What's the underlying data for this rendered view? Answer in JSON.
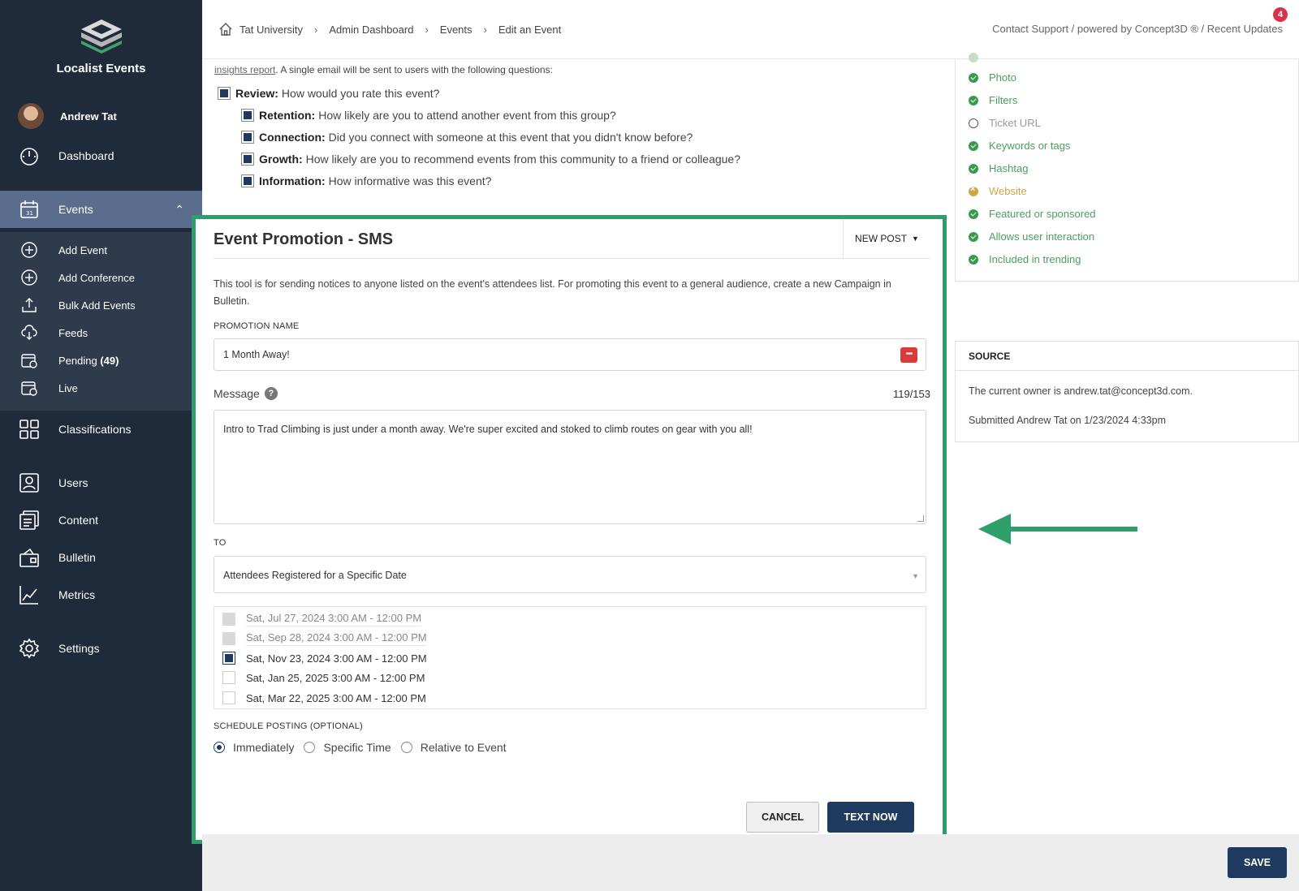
{
  "sidebar": {
    "brand": "Localist Events",
    "user_name": "Andrew Tat",
    "nav": {
      "dashboard": "Dashboard",
      "events": "Events",
      "classifications": "Classifications",
      "users": "Users",
      "content": "Content",
      "bulletin": "Bulletin",
      "metrics": "Metrics",
      "settings": "Settings"
    },
    "subnav": {
      "add_event": "Add Event",
      "add_conference": "Add Conference",
      "bulk_add": "Bulk Add Events",
      "feeds": "Feeds",
      "pending": "Pending",
      "pending_count": "(49)",
      "live": "Live"
    }
  },
  "topbar": {
    "breadcrumb": [
      "Tat University",
      "Admin Dashboard",
      "Events",
      "Edit an Event"
    ],
    "breadcrumb_sep": "›",
    "links": "Contact Support / powered by Concept3D ® / Recent Updates",
    "badge_count": "4"
  },
  "feedback": {
    "intro_link": "insights report",
    "intro_text": ". A single email will be sent to users with the following questions:",
    "questions": [
      {
        "label": "Review:",
        "text": "How would you rate this event?"
      },
      {
        "label": "Retention:",
        "text": "How likely are you to attend another event from this group?"
      },
      {
        "label": "Connection:",
        "text": "Did you connect with someone at this event that you didn't know before?"
      },
      {
        "label": "Growth:",
        "text": "How likely are you to recommend events from this community to a friend or colleague?"
      },
      {
        "label": "Information:",
        "text": "How informative was this event?"
      }
    ]
  },
  "promo": {
    "title": "Event Promotion - SMS",
    "new_post": "NEW POST",
    "description": "This tool is for sending notices to anyone listed on the event's attendees list. For promoting this event to a general audience, create a new Campaign in Bulletin.",
    "name_label": "PROMOTION NAME",
    "name_value": "1 Month Away!",
    "message_label": "Message",
    "message_counter": "119/153",
    "message_value": "Intro to Trad Climbing is just under a month away. We're super excited and stoked to climb routes on gear with you all!",
    "to_label": "TO",
    "to_value": "Attendees Registered for a Specific Date",
    "dates": [
      {
        "label": "Sat, Jul 27, 2024 3:00 AM - 12:00 PM",
        "state": "disabled"
      },
      {
        "label": "Sat, Sep 28, 2024 3:00 AM - 12:00 PM",
        "state": "disabled"
      },
      {
        "label": "Sat, Nov 23, 2024 3:00 AM - 12:00 PM",
        "state": "checked"
      },
      {
        "label": "Sat, Jan 25, 2025 3:00 AM - 12:00 PM",
        "state": "unchecked"
      },
      {
        "label": "Sat, Mar 22, 2025 3:00 AM - 12:00 PM",
        "state": "unchecked"
      }
    ],
    "schedule_label": "SCHEDULE POSTING (OPTIONAL)",
    "schedule_options": [
      "Immediately",
      "Specific Time",
      "Relative to Event"
    ],
    "schedule_selected": "Immediately",
    "cancel": "CANCEL",
    "submit": "TEXT NOW"
  },
  "checklist": [
    {
      "label": "Photo",
      "state": "done"
    },
    {
      "label": "Filters",
      "state": "done"
    },
    {
      "label": "Ticket URL",
      "state": "todo"
    },
    {
      "label": "Keywords or tags",
      "state": "done"
    },
    {
      "label": "Hashtag",
      "state": "done"
    },
    {
      "label": "Website",
      "state": "warn"
    },
    {
      "label": "Featured or sponsored",
      "state": "done"
    },
    {
      "label": "Allows user interaction",
      "state": "done"
    },
    {
      "label": "Included in trending",
      "state": "done"
    }
  ],
  "source": {
    "title": "SOURCE",
    "owner": "The current owner is andrew.tat@concept3d.com.",
    "submitted": "Submitted Andrew Tat on 1/23/2024 4:33pm"
  },
  "footer": {
    "save": "SAVE"
  },
  "colors": {
    "sidebar_bg": "#1f2a3a",
    "active_nav": "#5a6d8c",
    "primary": "#1f3a5f",
    "highlight": "#2e9e6b",
    "check_green": "#3a9a4c",
    "warn": "#c9a84a"
  }
}
